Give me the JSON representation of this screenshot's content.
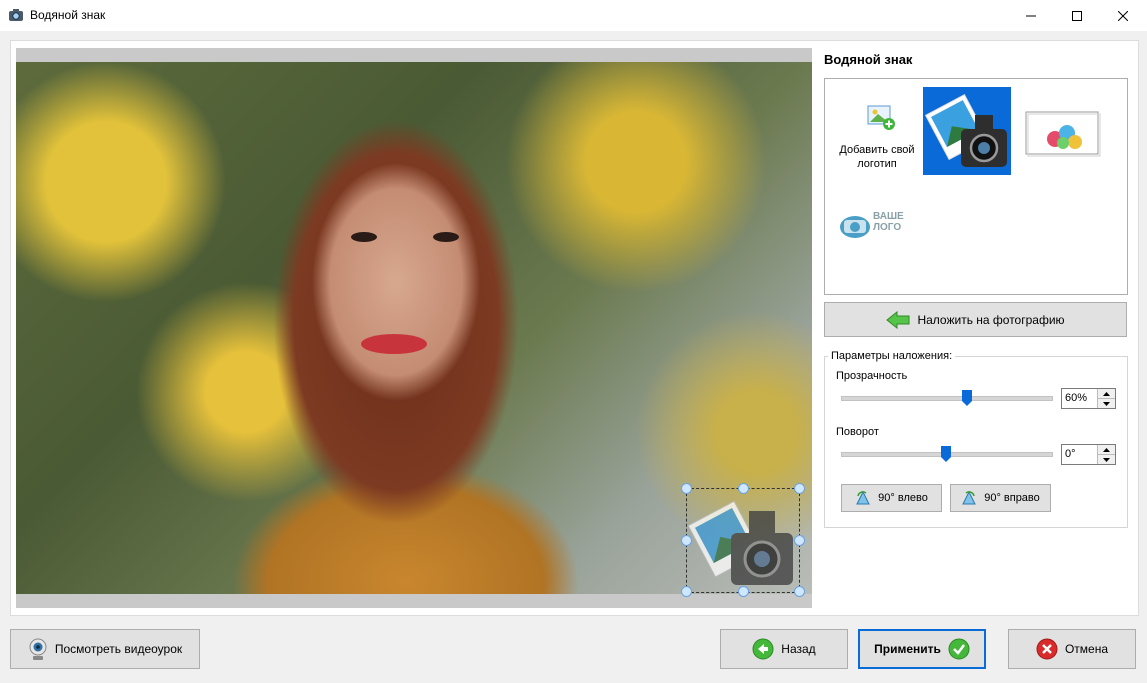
{
  "window": {
    "title": "Водяной знак"
  },
  "panel": {
    "title": "Водяной знак"
  },
  "gallery": {
    "add_logo_caption": "Добавить свой логотип",
    "logo_placeholder_text": "ВАШЕ ЛОГО"
  },
  "actions": {
    "apply_to_photo": "Наложить на фотографию"
  },
  "params": {
    "legend": "Параметры наложения:",
    "opacity": {
      "label": "Прозрачность",
      "value": "60%",
      "level": 0.6
    },
    "rotation": {
      "label": "Поворот",
      "value": "0°",
      "level": 0.5
    },
    "rotate_left": "90° влево",
    "rotate_right": "90° вправо"
  },
  "footer": {
    "video_lesson": "Посмотреть видеоурок",
    "back": "Назад",
    "apply": "Применить",
    "cancel": "Отмена"
  },
  "colors": {
    "selected_tile": "#0a6ad8",
    "arrow_green": "#3fb53a",
    "cancel_red": "#d92b2b"
  }
}
